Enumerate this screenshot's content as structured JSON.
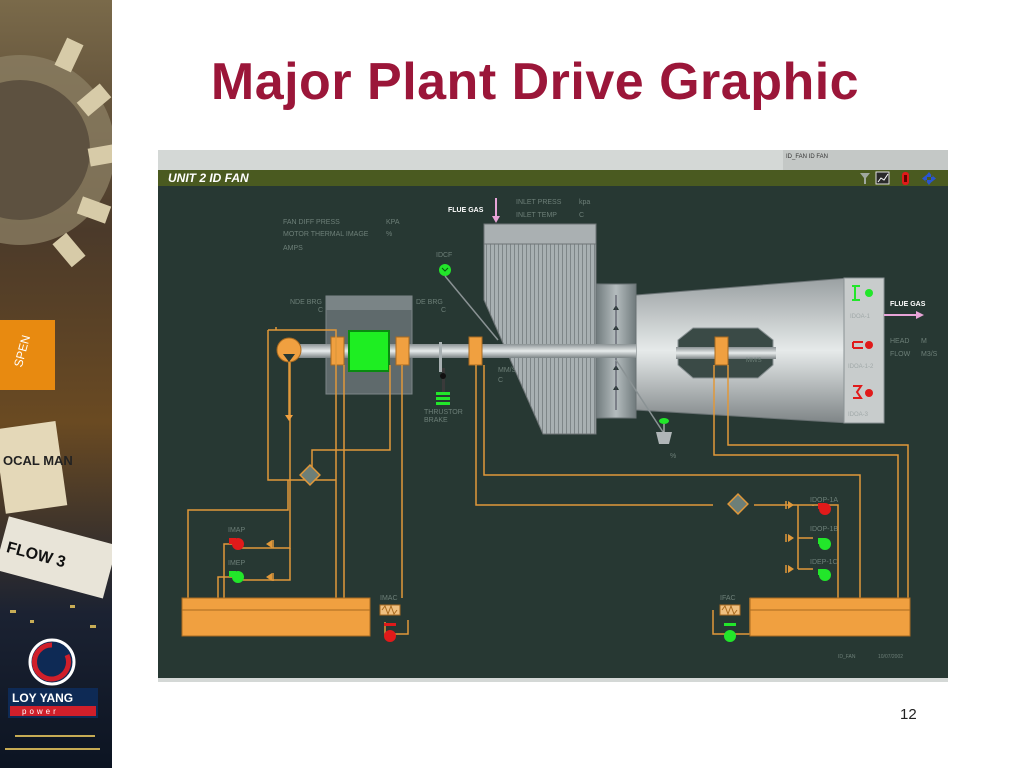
{
  "slide": {
    "title": "Major Plant Drive Graphic",
    "page_number": "12"
  },
  "branding": {
    "logo_text_top": "LOY YANG",
    "logo_text_bottom": "power",
    "sign_text_1": "SPEN",
    "sign_text_2": "OCAL MAN",
    "sign_text_3": "FLOW 3"
  },
  "hmi": {
    "window_tag": "ID_FAN ID FAN",
    "unit_title": "UNIT 2   ID FAN",
    "toolbar_icons": [
      "filter-icon",
      "trend-icon",
      "alarm-stop-icon",
      "navigate-icon"
    ],
    "flue_gas_in": "FLUE GAS",
    "flue_gas_out": "FLUE GAS",
    "inlet_press_label": "INLET PRESS",
    "inlet_press_unit": "kpa",
    "inlet_temp_label": "INLET TEMP",
    "inlet_temp_unit": "C",
    "fan_diff_press_label": "FAN DIFF PRESS",
    "fan_diff_press_unit": "KPA",
    "motor_thermal_label": "MOTOR THERMAL IMAGE",
    "motor_thermal_unit": "%",
    "amps_label": "AMPS",
    "idcf_label": "IDCF",
    "nde_brg_label": "NDE BRG",
    "nde_brg_unit": "C",
    "de_brg_label": "DE BRG",
    "de_brg_unit": "C",
    "thrustor_brake_line1": "THRUSTOR",
    "thrustor_brake_line2": "BRAKE",
    "mm_s_label": "MM/S",
    "mm_s_unit": "C",
    "head_label": "HEAD",
    "head_unit": "M",
    "flow_label": "FLOW",
    "flow_unit": "M3/S",
    "damper_labels": [
      "IDOA-1",
      "IDOA-1-2",
      "IDOA-3"
    ],
    "percent": "%",
    "imap_label": "IMAP",
    "imep_label": "IMEP",
    "imac_label": "IMAC",
    "ifac_label": "IFAC",
    "idop_1a_label": "IDOP-1A",
    "idop_1b_label": "IDOP-1B",
    "idep_1c_label": "IDEP-1C",
    "footer_left": "ID_FAN",
    "footer_right": "10/07/2002",
    "colors": {
      "background": "#273833",
      "pipe": "#e0983a",
      "tank": "#f0a040",
      "running": "#22e62a",
      "stopped": "#e01a1a",
      "title_bar": "#4a5a20",
      "title_text": "#9b1639"
    }
  }
}
